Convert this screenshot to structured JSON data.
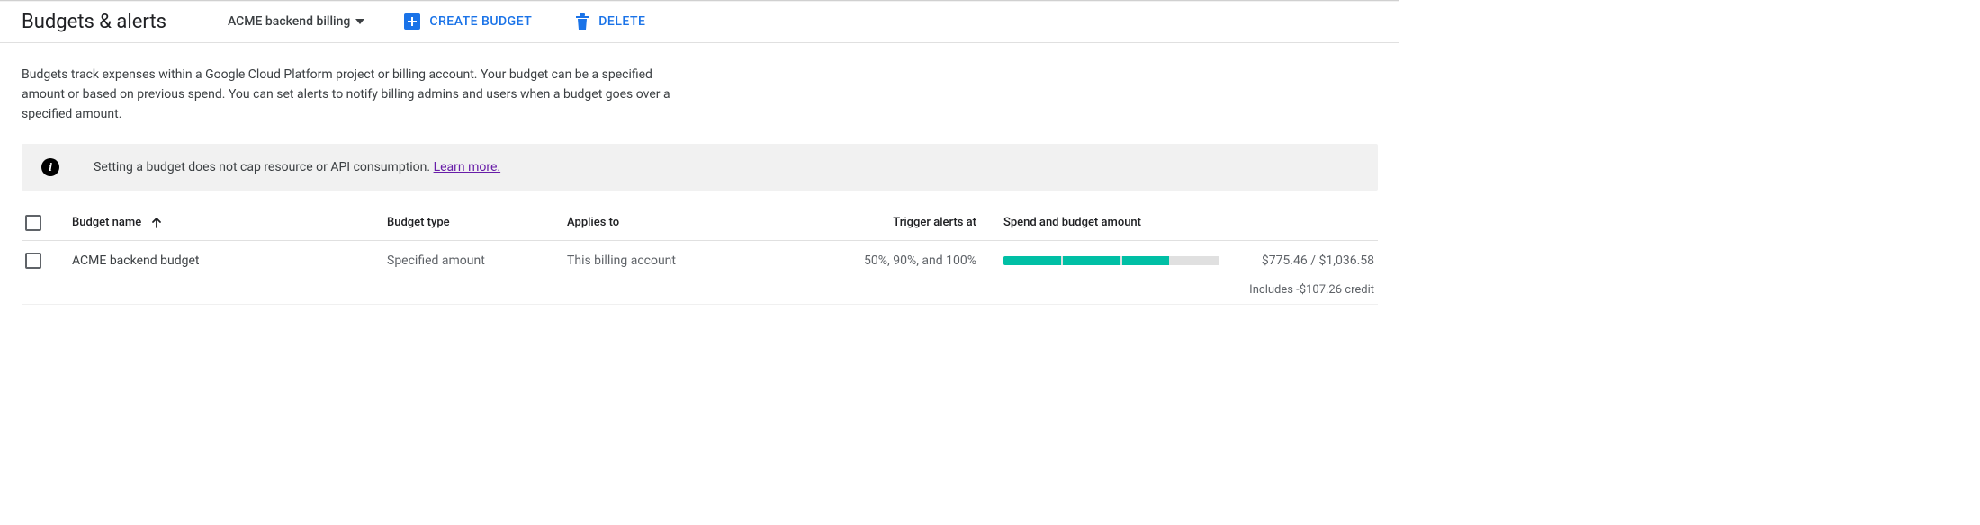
{
  "header": {
    "title": "Budgets & alerts",
    "account_selector": "ACME backend billing",
    "create_label": "CREATE BUDGET",
    "delete_label": "DELETE"
  },
  "intro_text": "Budgets track expenses within a Google Cloud Platform project or billing account. Your budget can be a specified amount or based on previous spend. You can set alerts to notify billing admins and users when a budget goes over a specified amount.",
  "info_banner": {
    "message": "Setting a budget does not cap resource or API consumption. ",
    "link_text": "Learn more."
  },
  "table": {
    "columns": {
      "name": "Budget name",
      "type": "Budget type",
      "applies": "Applies to",
      "trigger": "Trigger alerts at",
      "spend": "Spend and budget amount"
    },
    "rows": [
      {
        "name": "ACME backend budget",
        "type": "Specified amount",
        "applies": "This billing account",
        "trigger": "50%, 90%, and 100%",
        "spend_current": "$775.46",
        "spend_budget": "$1,036.58",
        "credit_line": "Includes -$107.26 credit",
        "progress_pct": 75
      }
    ]
  }
}
